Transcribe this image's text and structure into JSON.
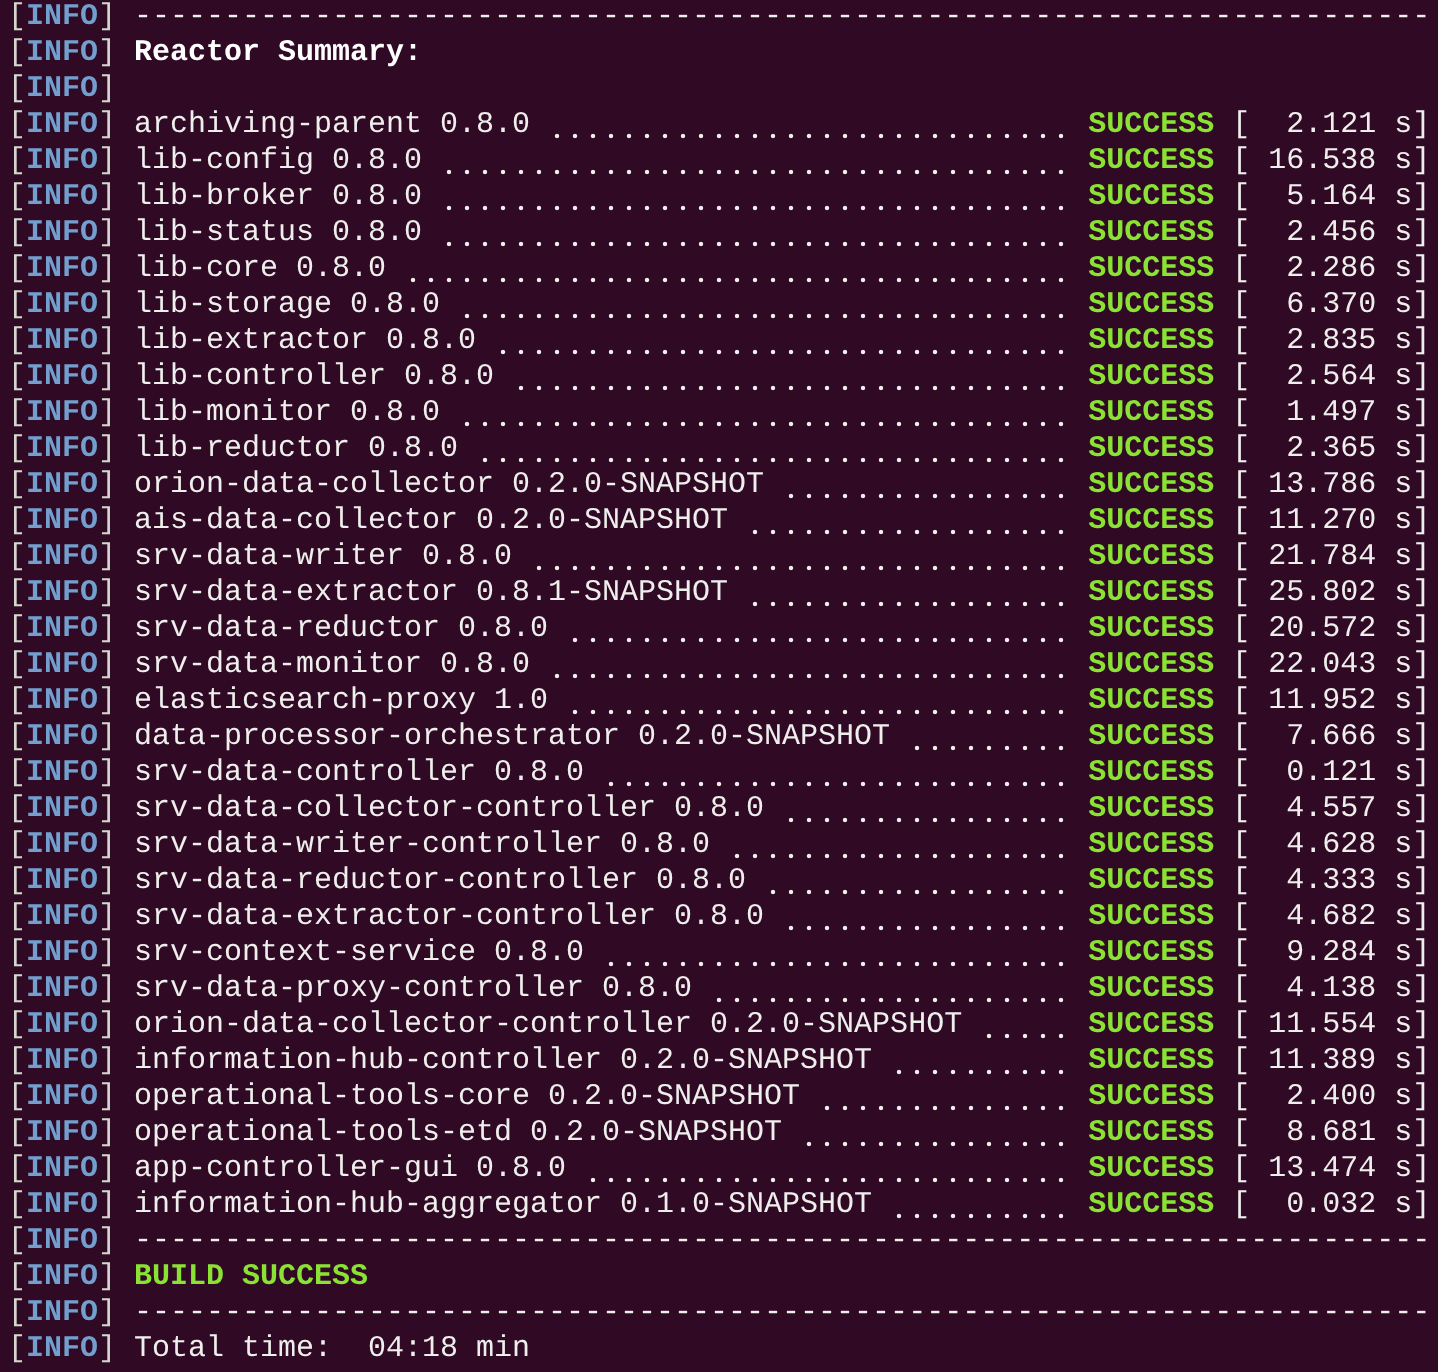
{
  "lines": [
    {
      "kind": "rule",
      "tag": "[**INFO**]",
      "text": "------------------------------------------------------------------------"
    },
    {
      "kind": "heading",
      "tag": "[**INFO**]",
      "text": "Reactor Summary:"
    },
    {
      "kind": "blank",
      "tag": "[**INFO**]"
    },
    {
      "kind": "module",
      "tag": "[**INFO**]",
      "module": "archiving-parent 0.8.0",
      "status": "SUCCESS",
      "time": "[  2.121 s]"
    },
    {
      "kind": "module",
      "tag": "[**INFO**]",
      "module": "lib-config 0.8.0",
      "status": "SUCCESS",
      "time": "[ 16.538 s]"
    },
    {
      "kind": "module",
      "tag": "[**INFO**]",
      "module": "lib-broker 0.8.0",
      "status": "SUCCESS",
      "time": "[  5.164 s]"
    },
    {
      "kind": "module",
      "tag": "[**INFO**]",
      "module": "lib-status 0.8.0",
      "status": "SUCCESS",
      "time": "[  2.456 s]"
    },
    {
      "kind": "module",
      "tag": "[**INFO**]",
      "module": "lib-core 0.8.0",
      "status": "SUCCESS",
      "time": "[  2.286 s]"
    },
    {
      "kind": "module",
      "tag": "[**INFO**]",
      "module": "lib-storage 0.8.0",
      "status": "SUCCESS",
      "time": "[  6.370 s]"
    },
    {
      "kind": "module",
      "tag": "[**INFO**]",
      "module": "lib-extractor 0.8.0",
      "status": "SUCCESS",
      "time": "[  2.835 s]"
    },
    {
      "kind": "module",
      "tag": "[**INFO**]",
      "module": "lib-controller 0.8.0",
      "status": "SUCCESS",
      "time": "[  2.564 s]"
    },
    {
      "kind": "module",
      "tag": "[**INFO**]",
      "module": "lib-monitor 0.8.0",
      "status": "SUCCESS",
      "time": "[  1.497 s]"
    },
    {
      "kind": "module",
      "tag": "[**INFO**]",
      "module": "lib-reductor 0.8.0",
      "status": "SUCCESS",
      "time": "[  2.365 s]"
    },
    {
      "kind": "module",
      "tag": "[**INFO**]",
      "module": "orion-data-collector 0.2.0-SNAPSHOT",
      "status": "SUCCESS",
      "time": "[ 13.786 s]"
    },
    {
      "kind": "module",
      "tag": "[**INFO**]",
      "module": "ais-data-collector 0.2.0-SNAPSHOT",
      "status": "SUCCESS",
      "time": "[ 11.270 s]"
    },
    {
      "kind": "module",
      "tag": "[**INFO**]",
      "module": "srv-data-writer 0.8.0",
      "status": "SUCCESS",
      "time": "[ 21.784 s]"
    },
    {
      "kind": "module",
      "tag": "[**INFO**]",
      "module": "srv-data-extractor 0.8.1-SNAPSHOT",
      "status": "SUCCESS",
      "time": "[ 25.802 s]"
    },
    {
      "kind": "module",
      "tag": "[**INFO**]",
      "module": "srv-data-reductor 0.8.0",
      "status": "SUCCESS",
      "time": "[ 20.572 s]"
    },
    {
      "kind": "module",
      "tag": "[**INFO**]",
      "module": "srv-data-monitor 0.8.0",
      "status": "SUCCESS",
      "time": "[ 22.043 s]"
    },
    {
      "kind": "module",
      "tag": "[**INFO**]",
      "module": "elasticsearch-proxy 1.0",
      "status": "SUCCESS",
      "time": "[ 11.952 s]"
    },
    {
      "kind": "module",
      "tag": "[**INFO**]",
      "module": "data-processor-orchestrator 0.2.0-SNAPSHOT",
      "status": "SUCCESS",
      "time": "[  7.666 s]"
    },
    {
      "kind": "module",
      "tag": "[**INFO**]",
      "module": "srv-data-controller 0.8.0",
      "status": "SUCCESS",
      "time": "[  0.121 s]"
    },
    {
      "kind": "module",
      "tag": "[**INFO**]",
      "module": "srv-data-collector-controller 0.8.0",
      "status": "SUCCESS",
      "time": "[  4.557 s]"
    },
    {
      "kind": "module",
      "tag": "[**INFO**]",
      "module": "srv-data-writer-controller 0.8.0",
      "status": "SUCCESS",
      "time": "[  4.628 s]"
    },
    {
      "kind": "module",
      "tag": "[**INFO**]",
      "module": "srv-data-reductor-controller 0.8.0",
      "status": "SUCCESS",
      "time": "[  4.333 s]"
    },
    {
      "kind": "module",
      "tag": "[**INFO**]",
      "module": "srv-data-extractor-controller 0.8.0",
      "status": "SUCCESS",
      "time": "[  4.682 s]"
    },
    {
      "kind": "module",
      "tag": "[**INFO**]",
      "module": "srv-context-service 0.8.0",
      "status": "SUCCESS",
      "time": "[  9.284 s]"
    },
    {
      "kind": "module",
      "tag": "[**INFO**]",
      "module": "srv-data-proxy-controller 0.8.0",
      "status": "SUCCESS",
      "time": "[  4.138 s]"
    },
    {
      "kind": "module",
      "tag": "[**INFO**]",
      "module": "orion-data-collector-controller 0.2.0-SNAPSHOT",
      "status": "SUCCESS",
      "time": "[ 11.554 s]"
    },
    {
      "kind": "module",
      "tag": "[**INFO**]",
      "module": "information-hub-controller 0.2.0-SNAPSHOT",
      "status": "SUCCESS",
      "time": "[ 11.389 s]"
    },
    {
      "kind": "module",
      "tag": "[**INFO**]",
      "module": "operational-tools-core 0.2.0-SNAPSHOT",
      "status": "SUCCESS",
      "time": "[  2.400 s]"
    },
    {
      "kind": "module",
      "tag": "[**INFO**]",
      "module": "operational-tools-etd 0.2.0-SNAPSHOT",
      "status": "SUCCESS",
      "time": "[  8.681 s]"
    },
    {
      "kind": "module",
      "tag": "[**INFO**]",
      "module": "app-controller-gui 0.8.0",
      "status": "SUCCESS",
      "time": "[ 13.474 s]"
    },
    {
      "kind": "module",
      "tag": "[**INFO**]",
      "module": "information-hub-aggregator 0.1.0-SNAPSHOT",
      "status": "SUCCESS",
      "time": "[  0.032 s]"
    },
    {
      "kind": "rule",
      "tag": "[**INFO**]",
      "text": "------------------------------------------------------------------------"
    },
    {
      "kind": "result",
      "tag": "[**INFO**]",
      "text": "BUILD SUCCESS"
    },
    {
      "kind": "rule",
      "tag": "[**INFO**]",
      "text": "------------------------------------------------------------------------"
    },
    {
      "kind": "text",
      "tag": "[**INFO**]",
      "text": "Total time:  04:18 min"
    }
  ]
}
